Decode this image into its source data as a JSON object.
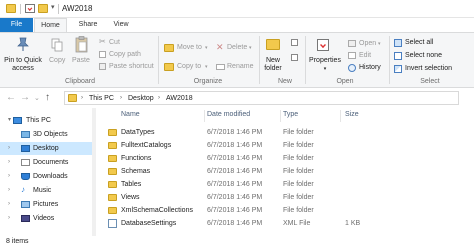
{
  "window": {
    "title": "AW2018",
    "qa_separator": "|",
    "qa_dropdown": "▾"
  },
  "tabs": [
    {
      "label": "File"
    },
    {
      "label": "Home"
    },
    {
      "label": "Share"
    },
    {
      "label": "View"
    }
  ],
  "ribbon": {
    "clipboard": {
      "pin_line1": "Pin to Quick",
      "pin_line2": "access",
      "copy": "Copy",
      "paste": "Paste",
      "cut": "Cut",
      "copy_path": "Copy path",
      "paste_shortcut": "Paste shortcut",
      "group_label": "Clipboard"
    },
    "organize": {
      "move_to": "Move to",
      "copy_to": "Copy to",
      "delete": "Delete",
      "rename": "Rename",
      "group_label": "Organize"
    },
    "new": {
      "new_folder_line1": "New",
      "new_folder_line2": "folder",
      "group_label": "New"
    },
    "open": {
      "properties": "Properties",
      "open": "Open",
      "edit": "Edit",
      "history": "History",
      "group_label": "Open"
    },
    "select": {
      "select_all": "Select all",
      "select_none": "Select none",
      "invert_selection": "Invert selection",
      "group_label": "Select"
    }
  },
  "address": {
    "back": "←",
    "forward": "→",
    "recent": "⌄",
    "up": "↑",
    "crumbs": [
      "This PC",
      "Desktop",
      "AW2018"
    ],
    "separator": "›"
  },
  "navpane": {
    "items": [
      {
        "label": "This PC",
        "icon": "computer-icon",
        "caret": "▾"
      },
      {
        "label": "3D Objects",
        "icon": "cube-icon",
        "caret": ""
      },
      {
        "label": "Desktop",
        "icon": "desktop-icon",
        "caret": "›"
      },
      {
        "label": "Documents",
        "icon": "document-icon",
        "caret": "›"
      },
      {
        "label": "Downloads",
        "icon": "download-icon",
        "caret": "›"
      },
      {
        "label": "Music",
        "icon": "music-icon",
        "caret": "›"
      },
      {
        "label": "Pictures",
        "icon": "picture-icon",
        "caret": "›"
      },
      {
        "label": "Videos",
        "icon": "video-icon",
        "caret": "›"
      }
    ]
  },
  "columns": {
    "name": "Name",
    "date": "Date modified",
    "type": "Type",
    "size": "Size"
  },
  "files": [
    {
      "name": "DataTypes",
      "date": "6/7/2018 1:46 PM",
      "type": "File folder",
      "size": "",
      "icon": "folder-icon"
    },
    {
      "name": "FulltextCatalogs",
      "date": "6/7/2018 1:46 PM",
      "type": "File folder",
      "size": "",
      "icon": "folder-icon"
    },
    {
      "name": "Functions",
      "date": "6/7/2018 1:46 PM",
      "type": "File folder",
      "size": "",
      "icon": "folder-icon"
    },
    {
      "name": "Schemas",
      "date": "6/7/2018 1:46 PM",
      "type": "File folder",
      "size": "",
      "icon": "folder-icon"
    },
    {
      "name": "Tables",
      "date": "6/7/2018 1:46 PM",
      "type": "File folder",
      "size": "",
      "icon": "folder-icon"
    },
    {
      "name": "Views",
      "date": "6/7/2018 1:46 PM",
      "type": "File folder",
      "size": "",
      "icon": "folder-icon"
    },
    {
      "name": "XmlSchemaCollections",
      "date": "6/7/2018 1:46 PM",
      "type": "File folder",
      "size": "",
      "icon": "folder-icon"
    },
    {
      "name": "DatabaseSettings",
      "date": "6/7/2018 1:46 PM",
      "type": "XML File",
      "size": "1 KB",
      "icon": "xml-file-icon"
    }
  ],
  "status": {
    "items": "8 items"
  },
  "colors": {
    "file_tab": "#1979ca",
    "selection": "#cce8ff",
    "folder": "#f2c94c"
  }
}
